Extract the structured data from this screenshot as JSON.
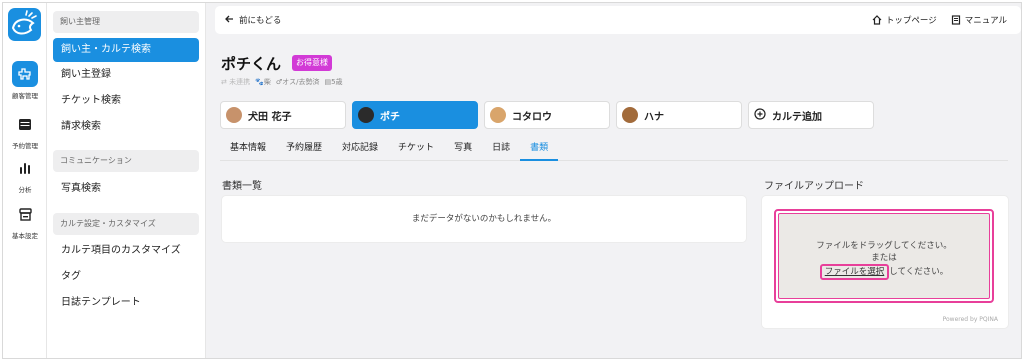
{
  "rail": {
    "items": [
      {
        "label": "顧客管理"
      },
      {
        "label": "予約管理"
      },
      {
        "label": "分析"
      },
      {
        "label": "基本設定"
      }
    ]
  },
  "sidebar": {
    "sections": [
      {
        "title": "飼い主管理"
      },
      {
        "title": "コミュニケーション"
      },
      {
        "title": "カルテ設定・カスタマイズ"
      }
    ],
    "items": [
      {
        "label": "飼い主・カルテ検索"
      },
      {
        "label": "飼い主登録"
      },
      {
        "label": "チケット検索"
      },
      {
        "label": "請求検索"
      },
      {
        "label": "写真検索"
      },
      {
        "label": "カルテ項目のカスタマイズ"
      },
      {
        "label": "タグ"
      },
      {
        "label": "日誌テンプレート"
      }
    ]
  },
  "topbar": {
    "back_label": "前にもどる",
    "top_page": "トップページ",
    "manual": "マニュアル"
  },
  "pet": {
    "name": "ポチくん",
    "badge": "お得意様",
    "meta_status": "未連携",
    "meta_breed": "柴",
    "meta_sex": "オス/去勢済",
    "meta_age": "5歳"
  },
  "chips": [
    {
      "label": "犬田 花子"
    },
    {
      "label": "ポチ"
    },
    {
      "label": "コタロウ"
    },
    {
      "label": "ハナ"
    },
    {
      "label": "カルテ追加"
    }
  ],
  "tabs": [
    {
      "label": "基本情報"
    },
    {
      "label": "予約履歴"
    },
    {
      "label": "対応記録"
    },
    {
      "label": "チケット"
    },
    {
      "label": "写真"
    },
    {
      "label": "日誌"
    },
    {
      "label": "書類"
    }
  ],
  "docs": {
    "title": "書類一覧",
    "empty": "まだデータがないのかもしれません。"
  },
  "upload": {
    "title": "ファイルアップロード",
    "line1": "ファイルをドラッグしてください。",
    "line2": "または",
    "pick": "ファイルを選択",
    "line3": "してください。",
    "powered": "Powered by PQINA"
  },
  "colors": {
    "accent": "#1a8fe0",
    "badge": "#d23ad6",
    "highlight": "#e83f9a"
  }
}
